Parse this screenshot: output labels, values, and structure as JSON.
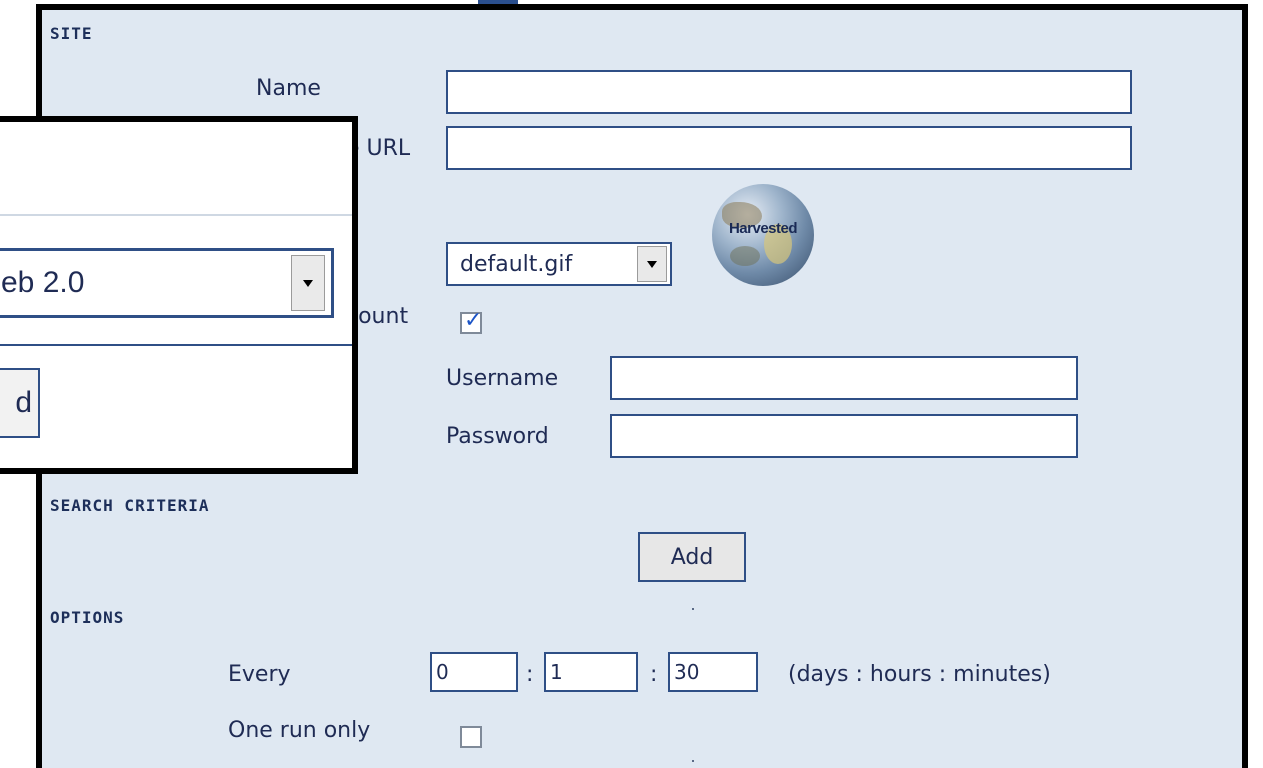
{
  "site": {
    "header": "SITE",
    "name_label": "Name",
    "name_value": "",
    "url_label_fragment": "e URL",
    "url_value": "",
    "icon_select_value": "default.gif",
    "icon_text": "Harvested",
    "account_label_fragment": "count",
    "account_checked": true,
    "username_label": "Username",
    "username_value": "",
    "password_label": "Password",
    "password_value": ""
  },
  "search_criteria": {
    "header": "SEARCH CRITERIA",
    "add_label": "Add"
  },
  "options": {
    "header": "OPTIONS",
    "every_label": "Every",
    "days_value": "0",
    "hours_value": "1",
    "minutes_value": "30",
    "separator": ":",
    "units_hint": "(days : hours : minutes)",
    "one_run_label": "One run only",
    "one_run_checked": false
  },
  "overlay": {
    "select_value_fragment": "eb 2.0",
    "button_fragment": "d"
  },
  "colors": {
    "panel_bg": "#dfe8f2",
    "text": "#1f2b54",
    "border": "#2f4f86",
    "check": "#1b54c7"
  },
  "icons": {
    "dropdown": "chevron-down-icon",
    "check": "checkmark-icon",
    "site_icon": "globe-icon"
  }
}
